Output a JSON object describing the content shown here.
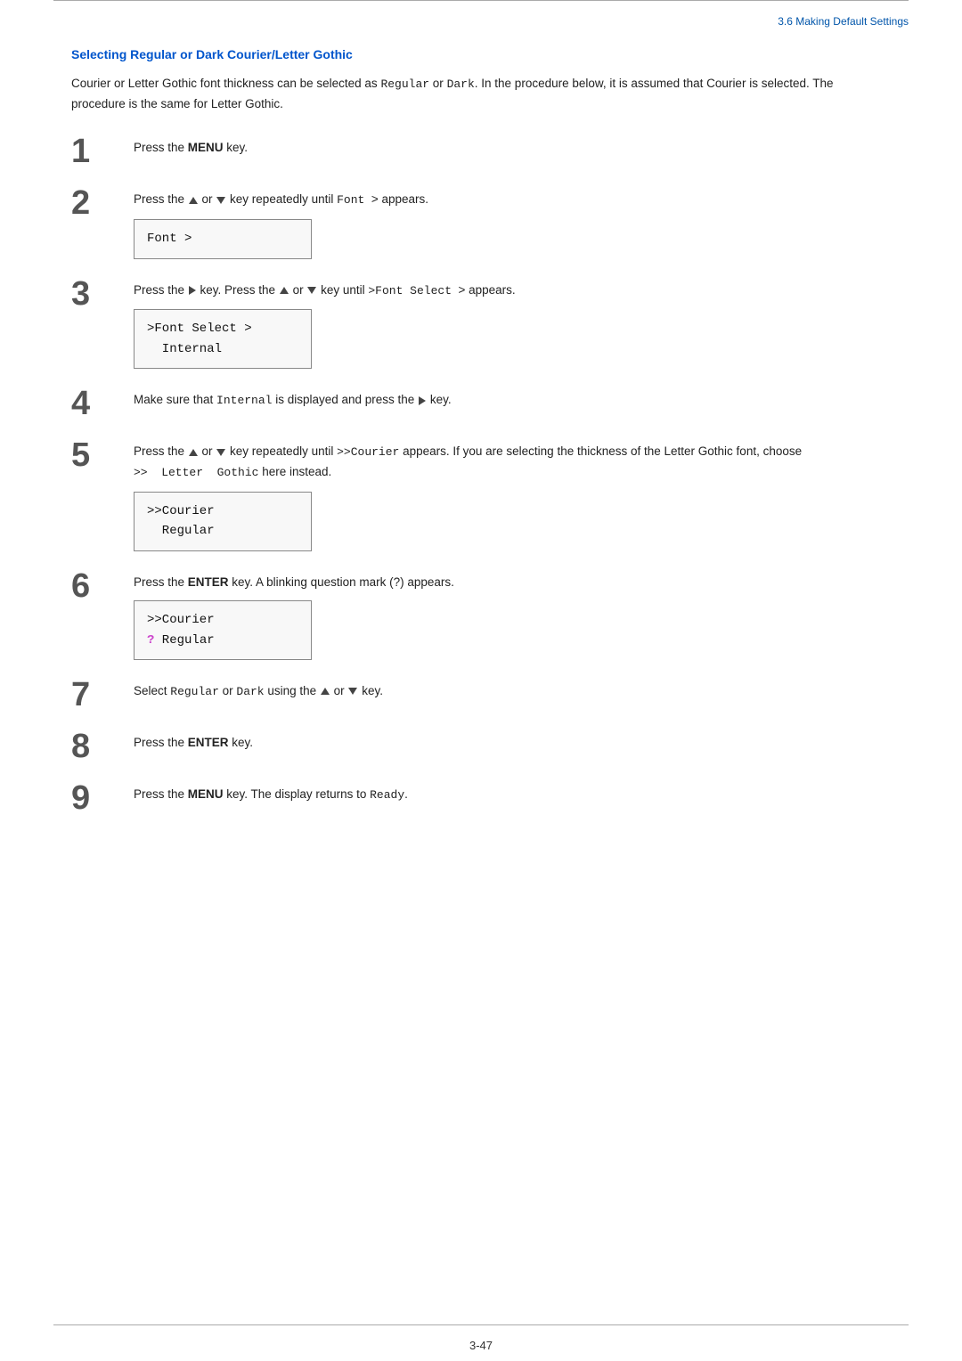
{
  "header": {
    "section": "3.6 Making Default Settings"
  },
  "section_title": "Selecting Regular or Dark Courier/Letter Gothic",
  "intro": "Courier or Letter Gothic font thickness can be selected as Regular or Dark. In the procedure below, it is assumed that Courier is selected. The procedure is the same for Letter Gothic.",
  "steps": [
    {
      "number": "1",
      "text": "Press the MENU key.",
      "has_lcd": false
    },
    {
      "number": "2",
      "text_prefix": "Press the ",
      "triangle_up": true,
      "text_middle": " or ",
      "triangle_down": true,
      "text_suffix": " key repeatedly until Font  > appears.",
      "has_lcd": true,
      "lcd_lines": [
        "Font              >"
      ]
    },
    {
      "number": "3",
      "text_prefix": "Press the ",
      "triangle_right": true,
      "text_middle": " key. Press the ",
      "triangle_up2": true,
      "text_middle2": " or ",
      "triangle_down2": true,
      "text_suffix": " key until >Font Select  > appears.",
      "has_lcd": true,
      "lcd_lines": [
        ">Font Select  >",
        "  Internal"
      ]
    },
    {
      "number": "4",
      "text_prefix": "Make sure that Internal is displayed and press the ",
      "triangle_right": true,
      "text_suffix": " key.",
      "has_lcd": false
    },
    {
      "number": "5",
      "text_prefix": "Press the ",
      "triangle_up": true,
      "text_middle": " or ",
      "triangle_down": true,
      "text_suffix": " key repeatedly until >>Courier appears. If you are selecting the thickness of the Letter Gothic font, choose >>  Letter  Gothic here instead.",
      "has_lcd": true,
      "lcd_lines": [
        ">>Courier",
        "  Regular"
      ]
    },
    {
      "number": "6",
      "text": "Press the ENTER key. A blinking question mark (?) appears.",
      "has_lcd": true,
      "lcd_lines": [
        ">>Courier",
        "? Regular"
      ],
      "has_blink": true
    },
    {
      "number": "7",
      "text_prefix": "Select Regular or Dark using the ",
      "triangle_up": true,
      "text_middle": " or ",
      "triangle_down": true,
      "text_suffix": " key.",
      "has_lcd": false
    },
    {
      "number": "8",
      "text": "Press the ENTER key.",
      "has_lcd": false
    },
    {
      "number": "9",
      "text_prefix": "Press the ",
      "bold_word": "MENU",
      "text_suffix": " key. The display returns to Ready.",
      "has_lcd": false
    }
  ],
  "page_number": "3-47"
}
